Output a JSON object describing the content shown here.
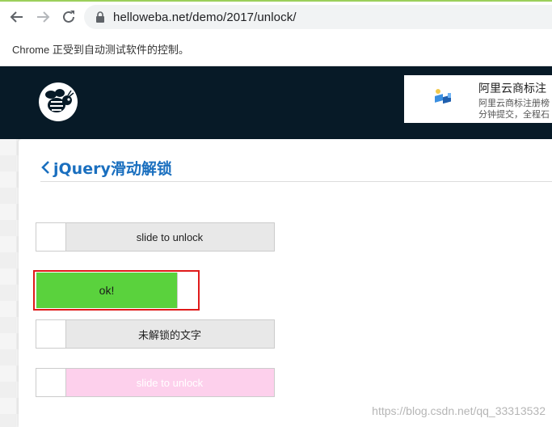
{
  "browser": {
    "url": "helloweba.net/demo/2017/unlock/",
    "automation_notice": "Chrome 正受到自动测试软件的控制。"
  },
  "ad": {
    "title": "阿里云商标注",
    "desc_line1": "阿里云商标注册榜",
    "desc_line2": "分钟提交，全程石"
  },
  "page": {
    "title": "jQuery滑动解锁"
  },
  "sliders": [
    {
      "label": "slide to unlock",
      "state": "locked"
    },
    {
      "label": "ok!",
      "state": "unlocked"
    },
    {
      "label": "未解锁的文字",
      "state": "locked"
    },
    {
      "label": "slide to unlock",
      "state": "locked"
    }
  ],
  "watermark": "https://blog.csdn.net/qq_33313532",
  "colors": {
    "header_bg": "#071a27",
    "title_blue": "#1a6fbf",
    "ok_green": "#5ad23d",
    "highlight_red": "#e01a1a",
    "pink_slider": "#fdd0ec"
  }
}
